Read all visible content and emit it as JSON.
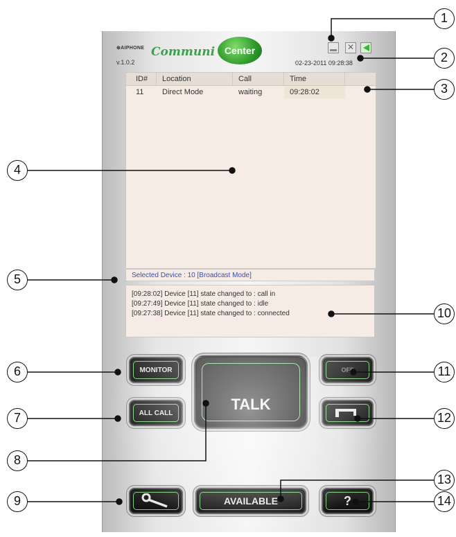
{
  "app": {
    "brand": "⊛AIPHONE",
    "logo_part1": "Communi",
    "logo_part2": "Center",
    "version": "v.1.0.2",
    "datetime": "02-23-2011 09:28:38"
  },
  "window_controls": {
    "minimize_icon": "minimize-icon",
    "close_label": "✕",
    "sound_icon": "speaker-icon"
  },
  "call_table": {
    "headers": [
      "ID#",
      "Location",
      "Call",
      "Time"
    ],
    "rows": [
      {
        "id": "11",
        "location": "Direct Mode",
        "call": "waiting",
        "time": "09:28:02"
      }
    ]
  },
  "selected_device": "Selected Device : 10  [Broadcast Mode]",
  "log": [
    "[09:28:02] Device [11] state changed to : call in",
    "[09:27:49] Device [11] state changed to : idle",
    "[09:27:38] Device [11] state changed to : connected"
  ],
  "buttons": {
    "monitor": "MONITOR",
    "all_call": "ALL CALL",
    "talk": "TALK",
    "off": "OFF",
    "door_icon": "door-release-icon",
    "tool_icon": "wrench-icon",
    "available": "AVAILABLE",
    "help": "?"
  },
  "callouts": [
    "1",
    "2",
    "3",
    "4",
    "5",
    "6",
    "7",
    "8",
    "9",
    "10",
    "11",
    "12",
    "13",
    "14"
  ],
  "colors": {
    "accent_green": "#3aa34a",
    "selected_text": "#3a4fb0",
    "list_bg": "#f6ece5"
  }
}
